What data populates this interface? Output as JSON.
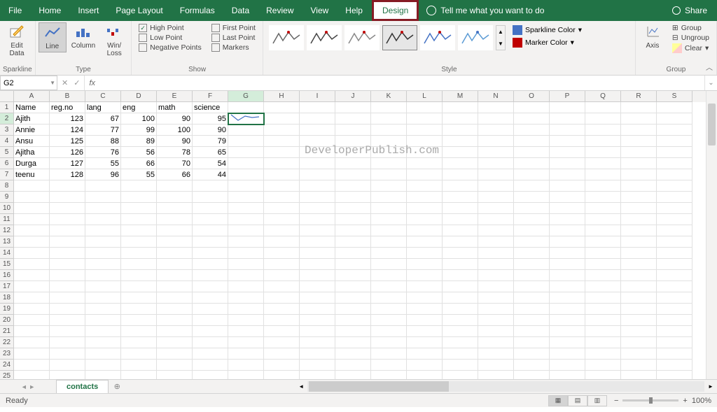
{
  "tabs": {
    "file": "File",
    "home": "Home",
    "insert": "Insert",
    "pagelayout": "Page Layout",
    "formulas": "Formulas",
    "data": "Data",
    "review": "Review",
    "view": "View",
    "help": "Help",
    "design": "Design"
  },
  "tellme": "Tell me what you want to do",
  "share": "Share",
  "ribbon": {
    "sparkline": {
      "label": "Sparkline",
      "edit": "Edit\nData"
    },
    "type": {
      "label": "Type",
      "line": "Line",
      "column": "Column",
      "winloss": "Win/\nLoss"
    },
    "show": {
      "label": "Show",
      "high": "High Point",
      "low": "Low Point",
      "neg": "Negative Points",
      "first": "First Point",
      "last": "Last Point",
      "markers": "Markers"
    },
    "style": {
      "label": "Style",
      "sparkline_color": "Sparkline Color",
      "marker_color": "Marker Color"
    },
    "group": {
      "label": "Group",
      "axis": "Axis",
      "group": "Group",
      "ungroup": "Ungroup",
      "clear": "Clear"
    }
  },
  "namebox": "G2",
  "fx": "fx",
  "columns": [
    "A",
    "B",
    "C",
    "D",
    "E",
    "F",
    "G",
    "H",
    "I",
    "J",
    "K",
    "L",
    "M",
    "N",
    "O",
    "P",
    "Q",
    "R",
    "S"
  ],
  "headers": {
    "A": "Name",
    "B": "reg.no",
    "C": "lang",
    "D": "eng",
    "E": "math",
    "F": "science"
  },
  "rows": [
    {
      "name": "Ajith",
      "reg": 123,
      "lang": 67,
      "eng": 100,
      "math": 90,
      "sci": 95
    },
    {
      "name": "Annie",
      "reg": 124,
      "lang": 77,
      "eng": 99,
      "math": 100,
      "sci": 90
    },
    {
      "name": "Ansu",
      "reg": 125,
      "lang": 88,
      "eng": 89,
      "math": 90,
      "sci": 79
    },
    {
      "name": "Ajitha",
      "reg": 126,
      "lang": 76,
      "eng": 56,
      "math": 78,
      "sci": 65
    },
    {
      "name": "Durga",
      "reg": 127,
      "lang": 55,
      "eng": 66,
      "math": 70,
      "sci": 54
    },
    {
      "name": "teenu",
      "reg": 128,
      "lang": 96,
      "eng": 55,
      "math": 66,
      "sci": 44
    }
  ],
  "watermark": "DeveloperPublish.com",
  "sheet": "contacts",
  "status": "Ready",
  "zoom": "100%",
  "chart_data": {
    "type": "line",
    "note": "Sparkline in cell G2 plotting row 2 numeric values",
    "categories": [
      "reg.no",
      "lang",
      "eng",
      "math",
      "sci"
    ],
    "values": [
      123,
      67,
      100,
      90,
      95
    ]
  }
}
